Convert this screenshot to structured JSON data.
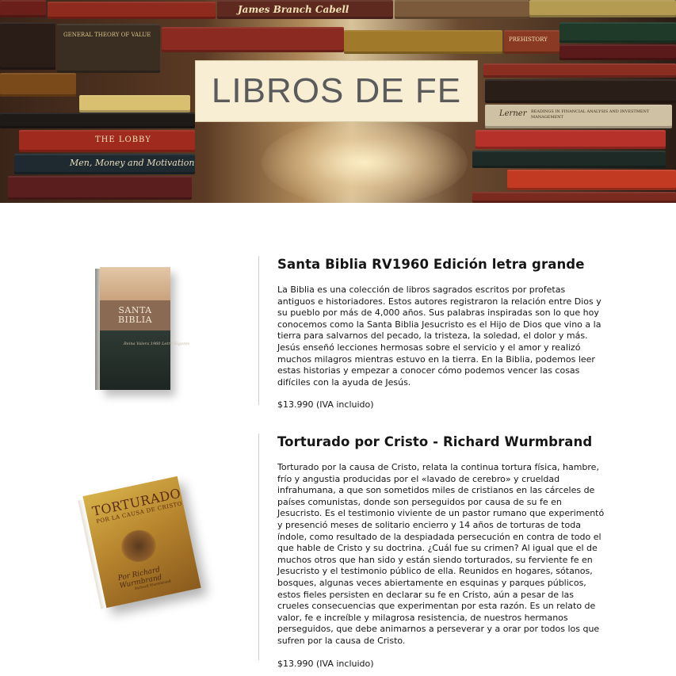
{
  "hero": {
    "title": "LIBROS DE FE",
    "spines": [
      "James Branch Cabell",
      "PREHISTORY",
      "Men, Money and Motivation",
      "THE LOBBY",
      "Lerner",
      "READINGS IN FINANCIAL ANALYSIS AND INVESTMENT MANAGEMENT",
      "GENERAL THEORY OF VALUE"
    ]
  },
  "products": [
    {
      "title": "Santa Biblia RV1960 Edición letra grande",
      "description": "La Biblia es una colección de libros sagrados escritos por profetas antiguos e historiadores. Estos autores registraron la relación entre Dios y su pueblo por más de 4,000 años. Sus palabras inspiradas son lo que hoy conocemos como la Santa Biblia Jesucristo es el Hijo de Dios que vino a la tierra para salvarnos del pecado, la tristeza, la soledad, el dolor y más. Jesús enseñó lecciones hermosas sobre el servicio y el amor y realizó muchos milagros mientras estuvo en la tierra. En la Biblia, podemos leer estas historias y empezar a conocer cómo podemos vencer las cosas difíciles con la ayuda de Jesús.",
      "price": "$13.990 (IVA incluido)",
      "cover": {
        "line1": "SANTA",
        "line2": "BIBLIA",
        "subtitle": "Reina Valera 1960 Letra Gigante"
      }
    },
    {
      "title": "Torturado por Cristo - Richard Wurmbrand",
      "description": "Torturado por la causa de Cristo, relata la continua tortura física, hambre, frío y angustia producidas por el «lavado de cerebro» y crueldad infrahumana, a que son sometidos miles de cristianos en las cárceles de países comunistas, donde son perseguidos por causa de su fe en Jesucristo. Es el testimonio viviente de un pastor rumano que experimentó y presenció meses de solitario encierro y 14 años de torturas de toda índole, como resultado de la despiadada persecución en contra de todo el que hable de Cristo y su doctrina. ¿Cuál fue su crimen? Al igual que el de muchos otros que han sido y están siendo torturados, su ferviente fe en Jesucristo y el testimonio público de ella. Reunidos en hogares, sótanos, bosques, algunas veces abiertamente en esquinas y parques públicos, estos fieles persisten en declarar su fe en Cristo, aún a pesar de las crueles consecuencias que experimentan por esta razón. Es un relato de valor, fe e increíble y milagrosa resistencia, de nuestros hermanos perseguidos, que debe animarnos a perseverar y a orar por todos los que sufren por la causa de Cristo.",
      "price": "$13.990 (IVA incluido)",
      "cover": {
        "line1": "TORTURADO",
        "line2": "POR LA CAUSA DE CRISTO",
        "signature": "Por Richard Wurmbrand",
        "author": "Richard Wurmbrand"
      }
    }
  ]
}
